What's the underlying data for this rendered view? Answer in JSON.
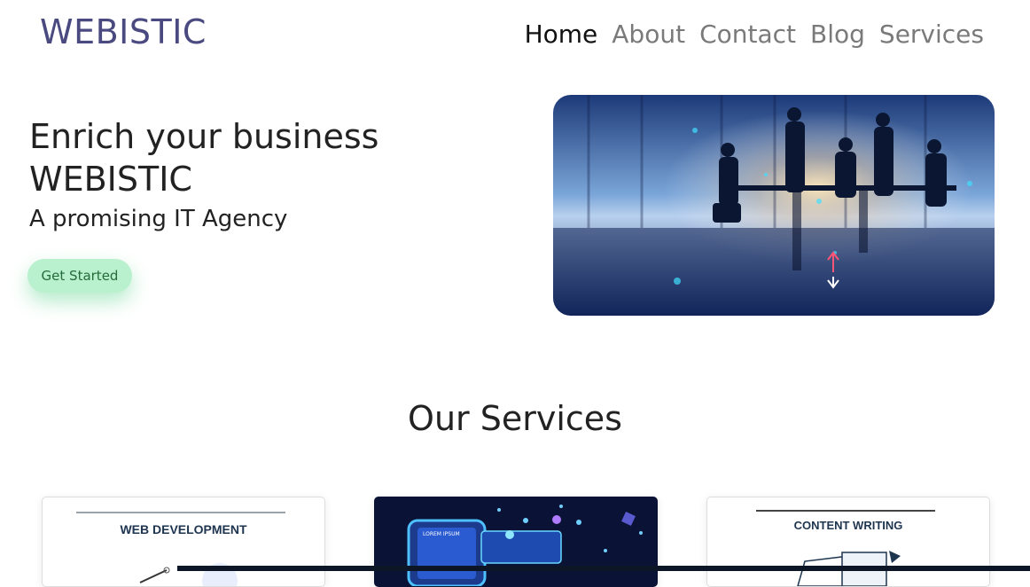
{
  "header": {
    "logo": "WEBISTIC",
    "nav": [
      "Home",
      "About",
      "Contact",
      "Blog",
      "Services"
    ]
  },
  "hero": {
    "title_line1": "Enrich your business",
    "title_line2": "WEBISTIC",
    "subtitle": "A promising IT Agency",
    "cta_label": "Get Started"
  },
  "services": {
    "heading": "Our Services",
    "cards": [
      {
        "label": "WEB DEVELOPMENT"
      },
      {
        "label": "LOREM IPSUM"
      },
      {
        "label": "CONTENT WRITING"
      }
    ]
  },
  "colors": {
    "logo": "#4a4a80",
    "nav_active": "#111111",
    "nav_inactive": "#7a7a7a",
    "cta_bg": "#b9f0cd"
  }
}
